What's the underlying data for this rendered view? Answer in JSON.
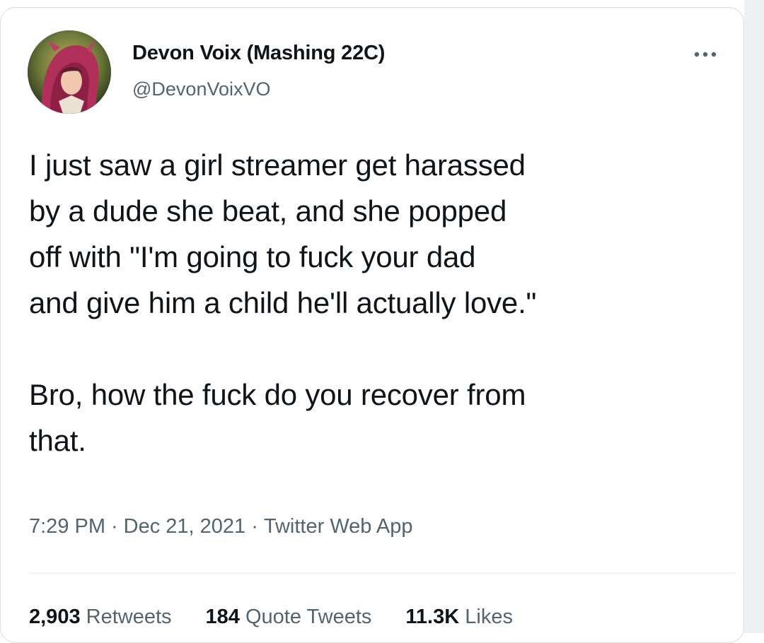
{
  "tweet": {
    "author": {
      "display_name": "Devon Voix (Mashing 22C)",
      "handle": "@DevonVoixVO",
      "avatar_icon": "avatar-illustration"
    },
    "more_icon": "more-horizontal-icon",
    "paragraphs": [
      [
        "I just saw a girl streamer get harassed",
        "by a dude she beat, and she popped",
        "off with \"I'm going to fuck your dad",
        "and give him a child he'll actually love.\""
      ],
      [
        "Bro, how the fuck do you recover from",
        "that."
      ]
    ],
    "meta": {
      "time": "7:29 PM",
      "date": "Dec 21, 2021",
      "source": "Twitter Web App",
      "separator": "·"
    },
    "stats": {
      "retweets_count": "2,903",
      "retweets_label": "Retweets",
      "quotes_count": "184",
      "quotes_label": "Quote Tweets",
      "likes_count": "11.3K",
      "likes_label": "Likes"
    }
  },
  "colors": {
    "text": "#0f1419",
    "secondary": "#536471",
    "border": "#d6dbdf"
  }
}
